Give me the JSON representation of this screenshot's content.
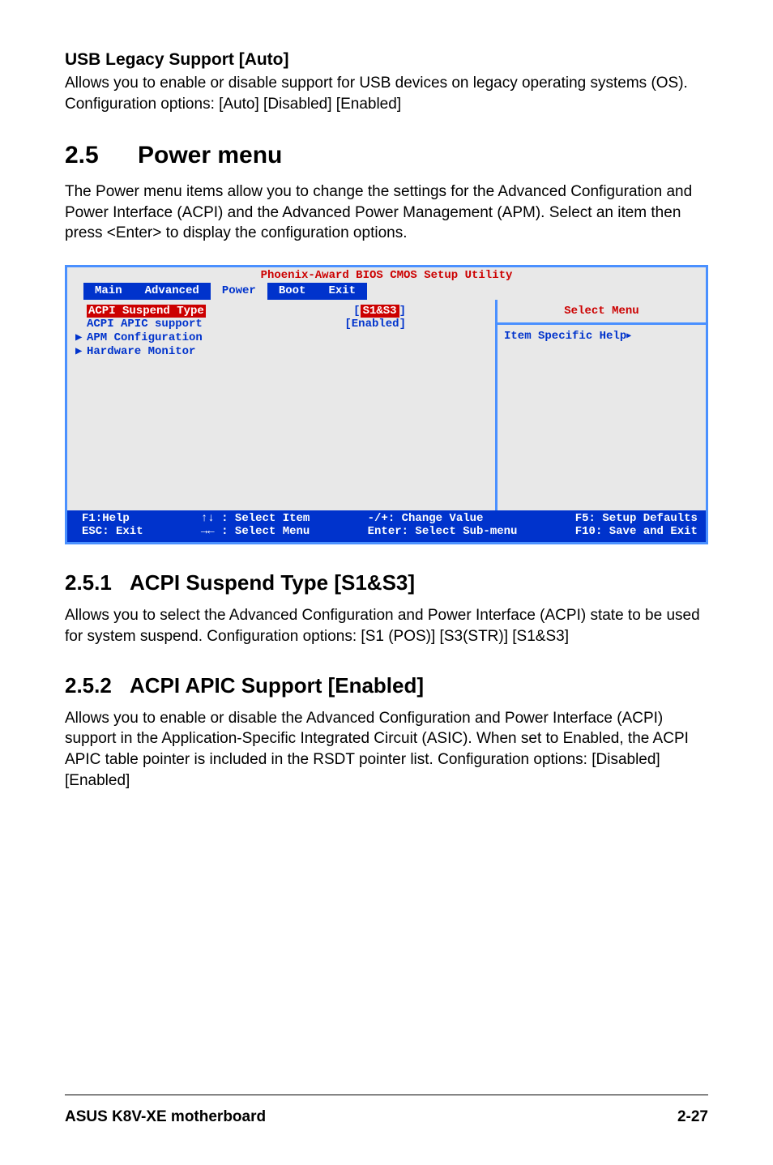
{
  "usb": {
    "heading": "USB Legacy Support [Auto]",
    "body": "Allows you to enable or disable support for USB devices on legacy operating systems (OS). Configuration options: [Auto] [Disabled] [Enabled]"
  },
  "section25": {
    "num": "2.5",
    "title": "Power menu",
    "body": "The Power menu items allow you to change the settings for the Advanced Configuration and Power Interface (ACPI) and the Advanced Power Management (APM). Select an item then press <Enter> to display the configuration options."
  },
  "bios": {
    "title": "Phoenix-Award BIOS CMOS Setup Utility",
    "tabs": [
      "Main",
      "Advanced",
      "Power",
      "Boot",
      "Exit"
    ],
    "active_tab_index": 2,
    "rows": [
      {
        "label": "ACPI Suspend Type",
        "value": "S1&S3",
        "selected": true,
        "sub": false
      },
      {
        "label": "ACPI APIC support",
        "value": "[Enabled]",
        "selected": false,
        "sub": false
      },
      {
        "label": "APM Configuration",
        "value": "",
        "selected": false,
        "sub": true
      },
      {
        "label": "Hardware Monitor",
        "value": "",
        "selected": false,
        "sub": true
      }
    ],
    "right_title": "Select Menu",
    "right_body": "Item Specific Help",
    "footer": {
      "c1a": "F1:Help",
      "c1b": "ESC: Exit",
      "c2a": "↑↓ : Select Item",
      "c2b": "→← : Select Menu",
      "c3a": "-/+: Change Value",
      "c3b": "Enter: Select Sub-menu",
      "c4a": "F5: Setup Defaults",
      "c4b": "F10: Save and Exit"
    }
  },
  "s251": {
    "num": "2.5.1",
    "title": "ACPI Suspend Type [S1&S3]",
    "body": "Allows you to select the Advanced Configuration and Power Interface (ACPI) state to be used for system suspend. Configuration options: [S1 (POS)] [S3(STR)] [S1&S3]"
  },
  "s252": {
    "num": "2.5.2",
    "title": "ACPI APIC Support [Enabled]",
    "body": "Allows you to enable or disable the Advanced Configuration and Power Interface (ACPI) support in the Application-Specific Integrated Circuit (ASIC). When set to Enabled, the ACPI APIC table pointer is included in the RSDT pointer list. Configuration options: [Disabled] [Enabled]"
  },
  "footer": {
    "left": "ASUS K8V-XE motherboard",
    "right": "2-27"
  }
}
